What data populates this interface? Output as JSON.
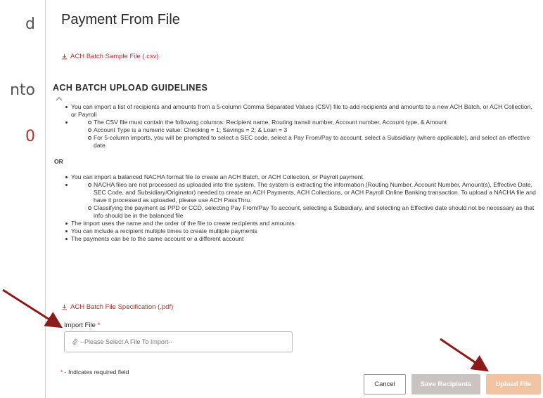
{
  "slide_fragments": [
    "d",
    "nto",
    "0"
  ],
  "dialog": {
    "title": "Payment From File",
    "sample_link": "ACH Batch Sample File (.csv)",
    "guidelines_heading": "ACH BATCH UPLOAD GUIDELINES",
    "section1": {
      "item1": "You can import a list of recipients and amounts from a 5-column Comma Separated Values (CSV) file to add recipients and amounts to a new ACH Batch, or ACH Collection, or Payroll",
      "sub1": "The CSV file must contain the following columns: Recipient name, Routing transit number, Account number, Account type, & Amount",
      "sub2": "Account Type is a numeric value: Checking = 1; Savings = 2; & Loan = 3",
      "sub3": "For 5-column imports, you will be prompted to select a SEC code, select a Pay From/Pay to account, select a Subsidiary (where applicable), and select an effective date"
    },
    "or_label": "OR",
    "section2": {
      "item1": "You can import a balanced NACHA format file to create an ACH Batch, or ACH Collection, or Payroll payment",
      "sub1": "NACHA files are not processed as uploaded into the system. The system is extracting the information (Routing Number, Account Number, Amount(s), Effective Date, SEC Code, and Subsidiary/Originator) needed to create an ACH Payments, ACH Collections, or ACH Payroll Online Banking transaction. To upload a NACHA file and have it processed as uploaded, please use ACH PassThru.",
      "sub2": "Classifying the payment as PPD or CCD, selecting Pay From/Pay To account, selecting a Subsidiary, and selecting an Effective date should not be necessary as that info should be in the balanced file",
      "item2": "The import uses the name and the order of the file to create recipients and amounts",
      "item3": "You can include a recipient multiple times to create multiple payments",
      "item4": "The payments can be to the same account or a different account"
    },
    "spec_link": "ACH Batch File Specification (.pdf)",
    "import_label": "Import File",
    "required_mark": "*",
    "file_placeholder": "--Please Select A File To Import--",
    "required_note": "- Indicates required field",
    "buttons": {
      "cancel": "Cancel",
      "save": "Save Recipients",
      "upload": "Upload File"
    }
  },
  "colors": {
    "link": "#b0312d",
    "arrow": "#8b1a1a",
    "save_disabled": "#c9c3c1",
    "upload_disabled": "#f2c3a2"
  }
}
